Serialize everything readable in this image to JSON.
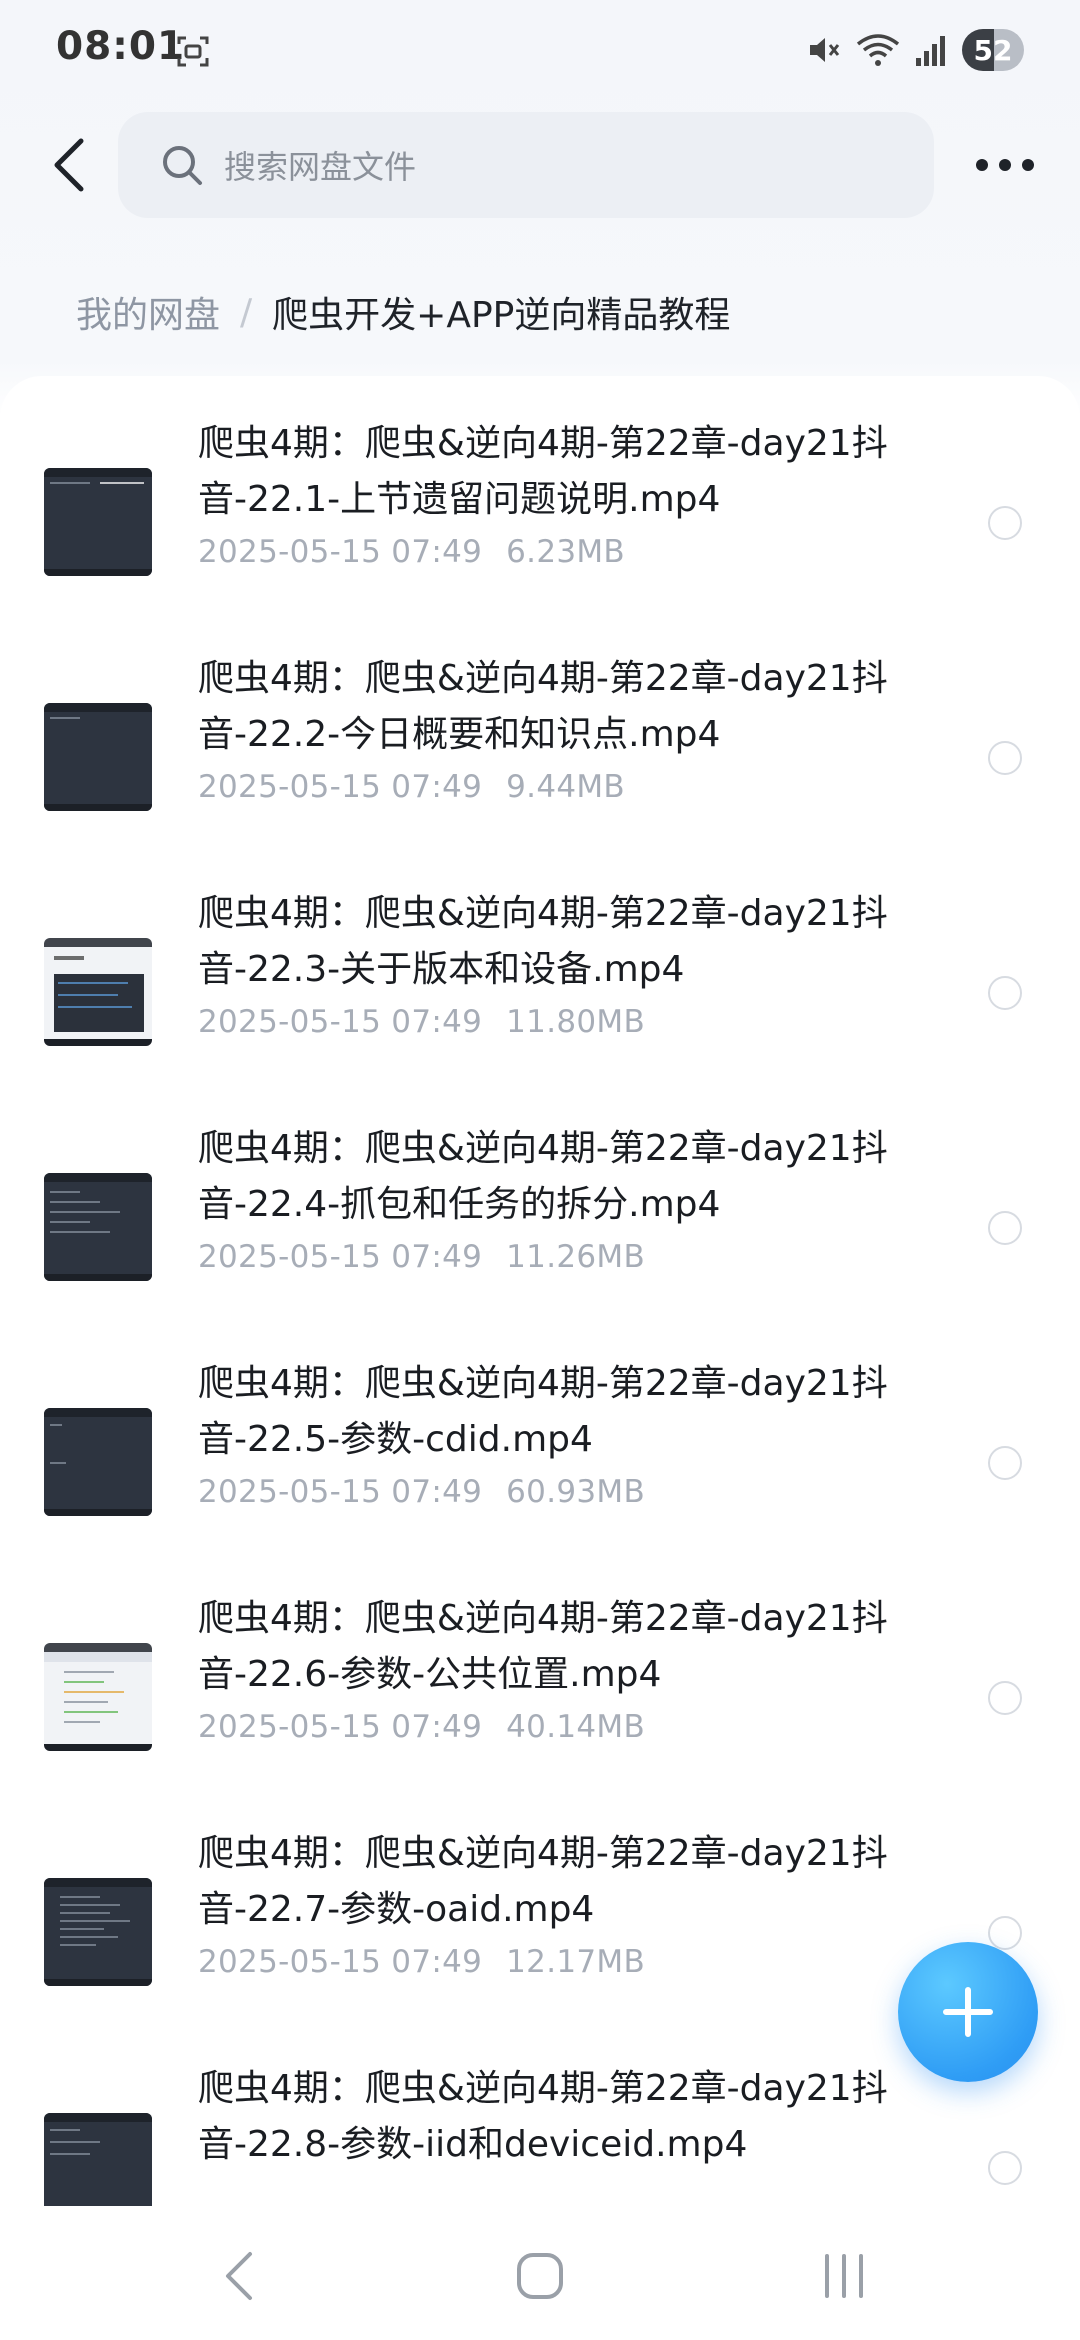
{
  "status_bar": {
    "time": "08:01",
    "battery": "52",
    "icons": [
      "screenshot-icon",
      "mute-icon",
      "wifi-icon",
      "signal-icon"
    ]
  },
  "header": {
    "back_icon": "chevron-left-icon",
    "search_placeholder": "搜索网盘文件",
    "more_icon": "more-horizontal-icon"
  },
  "breadcrumb": {
    "root": "我的网盘",
    "separator": "/",
    "current": "爬虫开发+APP逆向精品教程"
  },
  "files": [
    {
      "name": "爬虫4期：爬虫&逆向4期-第22章-day21抖音-22.1-上节遗留问题说明.mp4",
      "date": "2025-05-15  07:49",
      "size": "6.23MB"
    },
    {
      "name": "爬虫4期：爬虫&逆向4期-第22章-day21抖音-22.2-今日概要和知识点.mp4",
      "date": "2025-05-15  07:49",
      "size": "9.44MB"
    },
    {
      "name": "爬虫4期：爬虫&逆向4期-第22章-day21抖音-22.3-关于版本和设备.mp4",
      "date": "2025-05-15  07:49",
      "size": "11.80MB"
    },
    {
      "name": "爬虫4期：爬虫&逆向4期-第22章-day21抖音-22.4-抓包和任务的拆分.mp4",
      "date": "2025-05-15  07:49",
      "size": "11.26MB"
    },
    {
      "name": "爬虫4期：爬虫&逆向4期-第22章-day21抖音-22.5-参数-cdid.mp4",
      "date": "2025-05-15  07:49",
      "size": "60.93MB"
    },
    {
      "name": "爬虫4期：爬虫&逆向4期-第22章-day21抖音-22.6-参数-公共位置.mp4",
      "date": "2025-05-15  07:49",
      "size": "40.14MB"
    },
    {
      "name": "爬虫4期：爬虫&逆向4期-第22章-day21抖音-22.7-参数-oaid.mp4",
      "date": "2025-05-15  07:49",
      "size": "12.17MB"
    },
    {
      "name": "爬虫4期：爬虫&逆向4期-第22章-day21抖音-22.8-参数-iid和deviceid.mp4",
      "date": "",
      "size": ""
    }
  ],
  "fab": {
    "icon": "plus-icon"
  },
  "nav_bar": {
    "icons": [
      "nav-back-icon",
      "nav-home-icon",
      "nav-recents-icon"
    ]
  }
}
